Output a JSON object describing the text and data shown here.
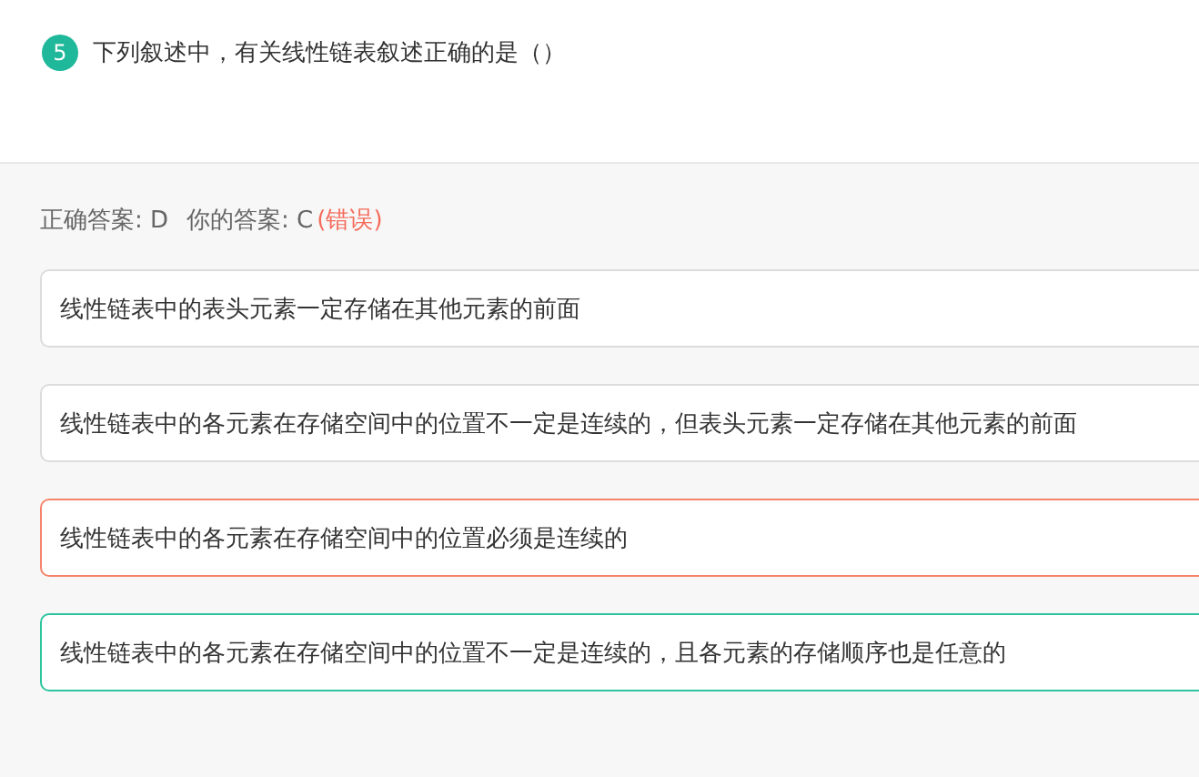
{
  "question": {
    "number": "5",
    "text": "下列叙述中，有关线性链表叙述正确的是（）"
  },
  "answer": {
    "correct_label": "正确答案: D",
    "your_label": "你的答案: C",
    "verdict": "(错误)"
  },
  "options": [
    {
      "text": "线性链表中的表头元素一定存储在其他元素的前面",
      "kind": "normal"
    },
    {
      "text": "线性链表中的各元素在存储空间中的位置不一定是连续的，但表头元素一定存储在其他元素的前面",
      "kind": "normal"
    },
    {
      "text": "线性链表中的各元素在存储空间中的位置必须是连续的",
      "kind": "wrong"
    },
    {
      "text": "线性链表中的各元素在存储空间中的位置不一定是连续的，且各元素的存储顺序也是任意的",
      "kind": "correct"
    }
  ]
}
